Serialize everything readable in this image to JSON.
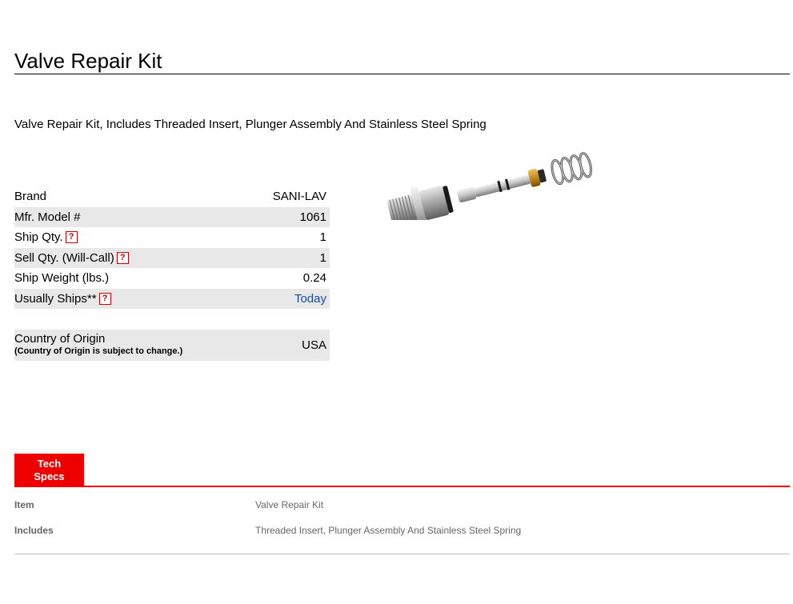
{
  "page": {
    "title": "Valve Repair Kit",
    "description": "Valve Repair Kit, Includes Threaded Insert, Plunger Assembly And Stainless Steel Spring"
  },
  "specs": {
    "help_glyph": "?",
    "rows": [
      {
        "label": "Brand",
        "value": "SANI-LAV"
      },
      {
        "label": "Mfr. Model #",
        "value": "1061"
      },
      {
        "label": "Ship Qty.",
        "value": "1"
      },
      {
        "label": "Sell Qty. (Will-Call)",
        "value": "1"
      },
      {
        "label": "Ship Weight (lbs.)",
        "value": "0.24"
      },
      {
        "label": "Usually Ships**",
        "value": "Today"
      }
    ]
  },
  "origin": {
    "label": "Country of Origin",
    "note": "(Country of Origin is subject to change.)",
    "value": "USA"
  },
  "product_image": {
    "icon": "valve-repair-kit-parts"
  },
  "tech_specs": {
    "tab_line1": "Tech",
    "tab_line2": "Specs",
    "rows": [
      {
        "key": "Item",
        "value": "Valve Repair Kit"
      },
      {
        "key": "Includes",
        "value": "Threaded Insert, Plunger Assembly And Stainless Steel Spring"
      }
    ]
  },
  "colors": {
    "accent": "#ee0000",
    "link": "#1a4ba8",
    "row_shade": "#e8e8e8"
  }
}
